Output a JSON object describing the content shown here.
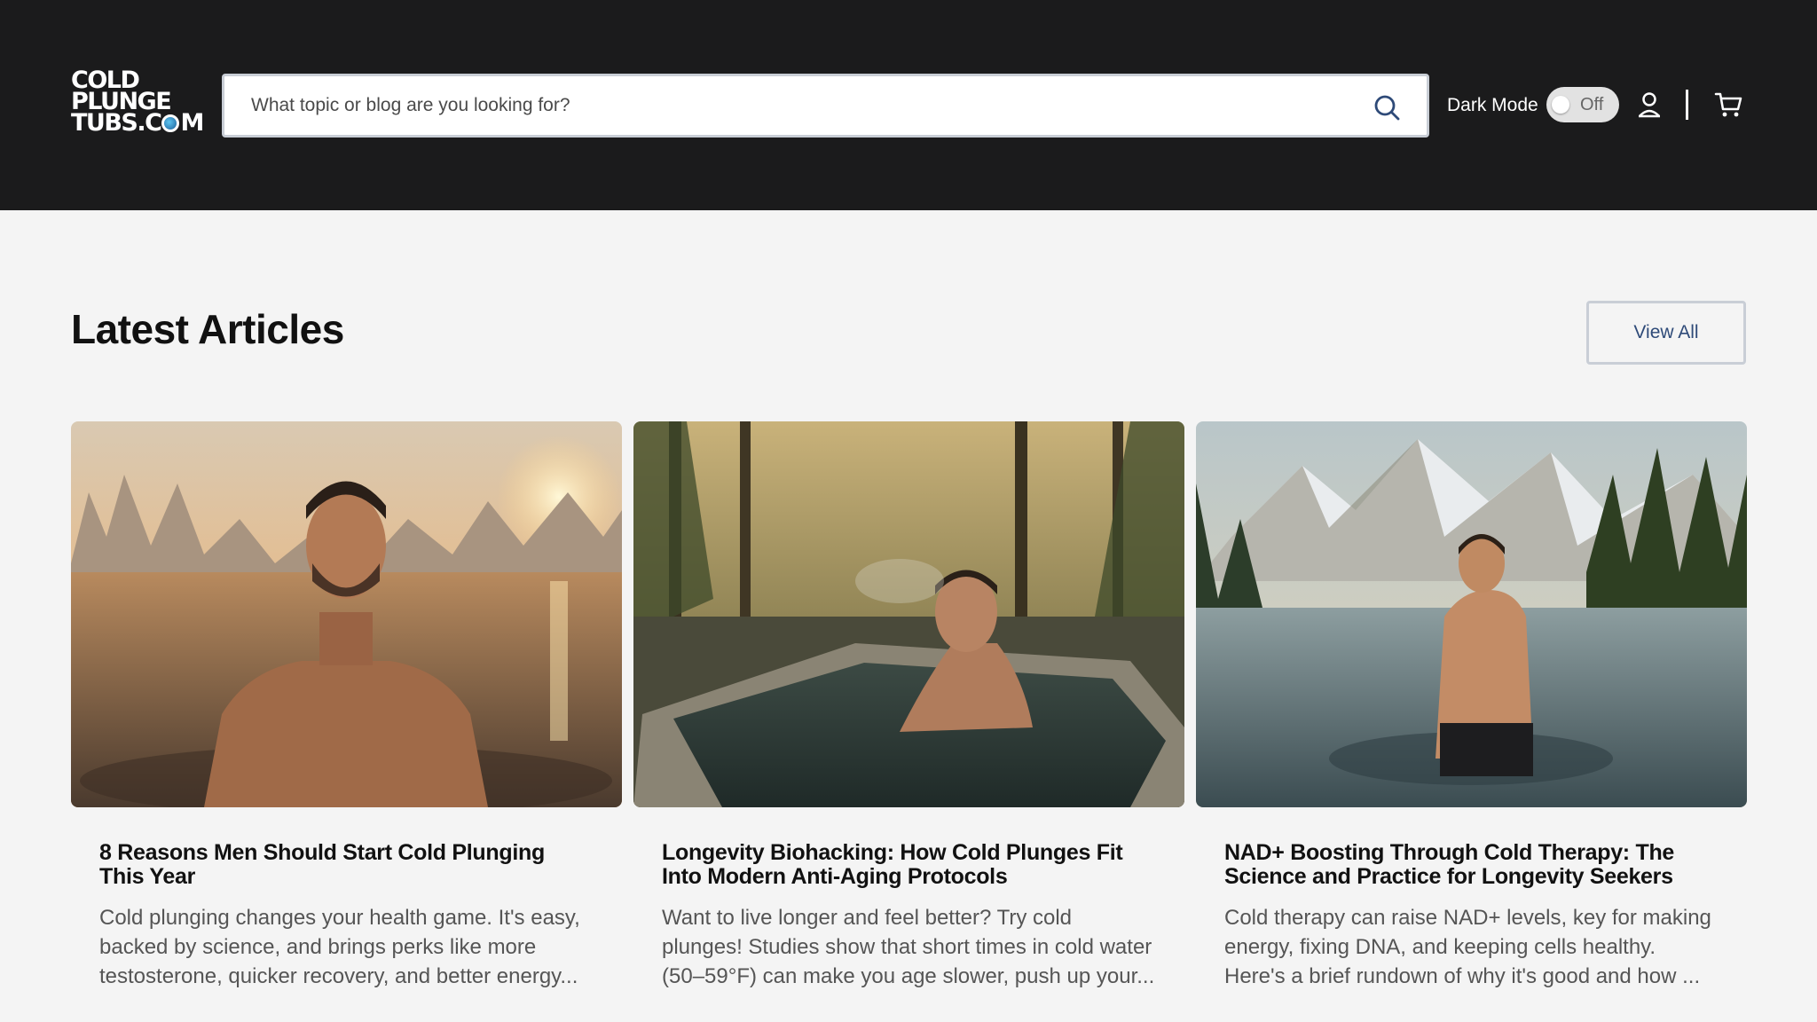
{
  "header": {
    "logo_lines": [
      "COLD",
      "PLUNGE",
      "TUBS.C",
      "M"
    ],
    "search": {
      "placeholder": "What topic or blog are you looking for?"
    },
    "dark_mode": {
      "label": "Dark Mode",
      "state": "Off"
    },
    "icons": {
      "search": "search-icon",
      "account": "user-icon",
      "cart": "cart-icon"
    }
  },
  "section": {
    "title": "Latest Articles",
    "view_all": "View All"
  },
  "articles": [
    {
      "title": "8 Reasons Men Should Start Cold Plunging This Year",
      "excerpt": "Cold plunging changes your health game. It's easy, backed by science, and brings perks like more testosterone, quicker recovery, and better energy..."
    },
    {
      "title": "Longevity Biohacking: How Cold Plunges Fit Into Modern Anti-Aging Protocols",
      "excerpt": "Want to live longer and feel better? Try cold plunges! Studies show that short times in cold water (50–59°F) can make you age slower, push up your..."
    },
    {
      "title": "NAD+ Boosting Through Cold Therapy: The Science and Practice for Longevity Seekers",
      "excerpt": "Cold therapy can raise NAD+ levels, key for making energy, fixing DNA, and keeping cells healthy. Here's a brief rundown of why it's good and how ..."
    }
  ],
  "colors": {
    "header_bg": "#1b1b1c",
    "page_bg": "#f4f4f4",
    "accent": "#2e4a78"
  }
}
